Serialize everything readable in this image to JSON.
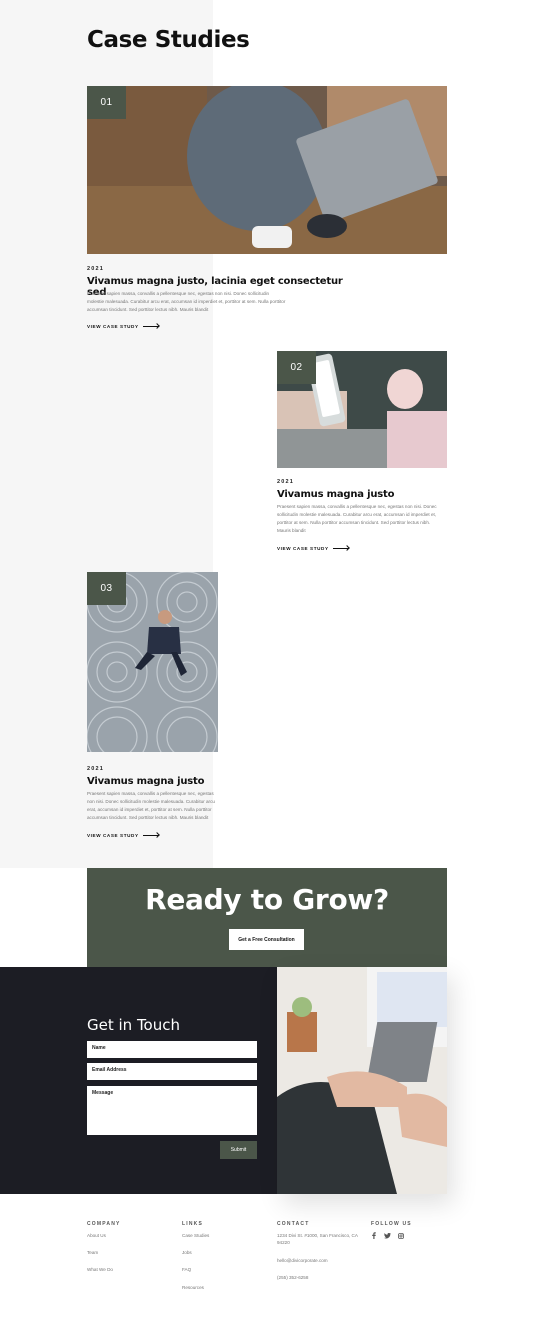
{
  "page_title": "Case Studies",
  "cases": [
    {
      "num": "01",
      "year": "2021",
      "title": "Vivamus magna justo, lacinia eget consectetur sed",
      "desc": "Praesent sapien massa, convallis a pellentesque nec, egestas non nisi. Donec sollicitudin molestie malesuada. Curabitur arcu erat, accumsan id imperdiet et, porttitor at sem. Nulla porttitor accumsan tincidunt. Sed porttitor lectus nibh. Mauris blandit",
      "link": "VIEW CASE STUDY"
    },
    {
      "num": "02",
      "year": "2021",
      "title": "Vivamus magna justo",
      "desc": "Praesent sapien massa, convallis a pellentesque nec, egestas non nisi. Donec sollicitudin molestie malesuada. Curabitur arcu erat, accumsan id imperdiet et, porttitor at sem. Nulla porttitor accumsan tincidunt. Sed porttitor lectus nibh. Mauris blandit",
      "link": "VIEW CASE STUDY"
    },
    {
      "num": "03",
      "year": "2021",
      "title": "Vivamus magna justo",
      "desc": "Praesent sapien massa, convallis a pellentesque nec, egestas non nisi. Donec sollicitudin molestie malesuada. Curabitur arcu erat, accumsan id imperdiet et, porttitor at sem. Nulla porttitor accumsan tincidunt. Sed porttitor lectus nibh. Mauris blandit",
      "link": "VIEW CASE STUDY"
    }
  ],
  "cta": {
    "heading": "Ready to Grow?",
    "button": "Get a Free Consultation"
  },
  "contact": {
    "heading": "Get in Touch",
    "name_label": "Name",
    "email_label": "Email Address",
    "message_label": "Message",
    "submit": "Submit"
  },
  "footer": {
    "company": {
      "heading": "COMPANY",
      "items": [
        "About Us",
        "Team",
        "What We Do"
      ]
    },
    "links": {
      "heading": "LINKS",
      "items": [
        "Case Studies",
        "Jobs",
        "FAQ",
        "Resources"
      ]
    },
    "contact": {
      "heading": "CONTACT",
      "address": "1234 Divi St. #1000, San Francisco, CA 94220",
      "email": "hello@divicorporate.com",
      "phone": "(255) 352-6258"
    },
    "follow": {
      "heading": "FOLLOW US",
      "icons": [
        "facebook-icon",
        "twitter-icon",
        "instagram-icon"
      ]
    }
  },
  "colors": {
    "accent": "#4b5649",
    "dark": "#1c1d24",
    "light_bg": "#f6f6f6"
  }
}
